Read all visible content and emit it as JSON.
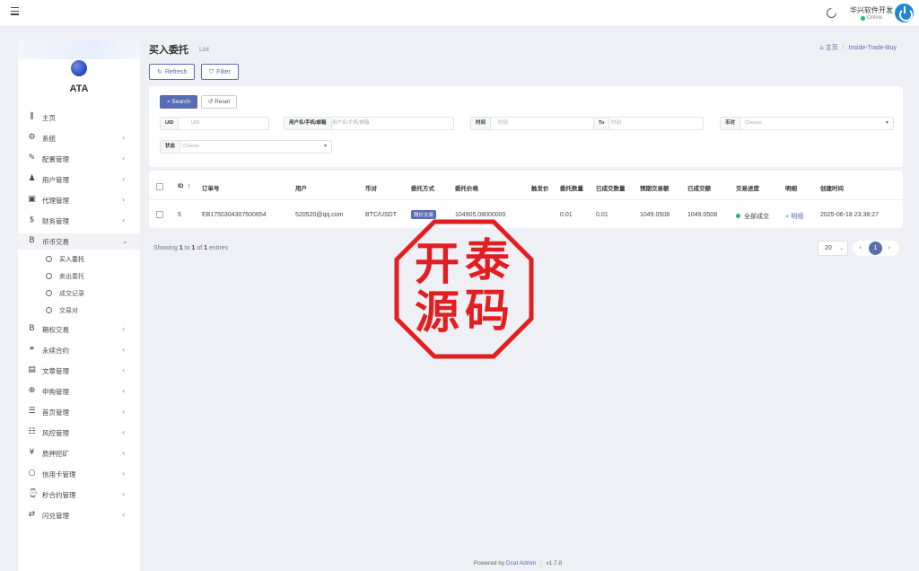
{
  "header": {
    "user_name": "华兴软件开发",
    "user_status": "Online"
  },
  "sidebar": {
    "brand": "ATA",
    "items": [
      {
        "label": "主页",
        "icon": "chart-bar-icon",
        "glyph": "⫼",
        "arrow": ""
      },
      {
        "label": "系统",
        "icon": "gear-icon",
        "glyph": "⚙",
        "arrow": "‹"
      },
      {
        "label": "配置管理",
        "icon": "wrench-icon",
        "glyph": "✎",
        "arrow": "‹"
      },
      {
        "label": "用户管理",
        "icon": "user-icon",
        "glyph": "♟",
        "arrow": "‹"
      },
      {
        "label": "代理管理",
        "icon": "id-card-icon",
        "glyph": "▣",
        "arrow": "‹"
      },
      {
        "label": "财务管理",
        "icon": "dollar-icon",
        "glyph": "$",
        "arrow": "‹"
      },
      {
        "label": "币币交易",
        "icon": "bitcoin-icon",
        "glyph": "B",
        "arrow": "⌄"
      }
    ],
    "sub_items": [
      {
        "label": "买入委托"
      },
      {
        "label": "卖出委托"
      },
      {
        "label": "成交记录"
      },
      {
        "label": "交易对"
      }
    ],
    "items_after": [
      {
        "label": "期权交易",
        "icon": "bitcoin-icon",
        "glyph": "B",
        "arrow": "‹"
      },
      {
        "label": "永续合约",
        "icon": "link-icon",
        "glyph": "⚭",
        "arrow": "‹"
      },
      {
        "label": "文章管理",
        "icon": "newspaper-icon",
        "glyph": "▤",
        "arrow": "‹"
      },
      {
        "label": "申购管理",
        "icon": "life-ring-icon",
        "glyph": "⊕",
        "arrow": "‹"
      },
      {
        "label": "首页管理",
        "icon": "list-icon",
        "glyph": "☰",
        "arrow": "‹"
      },
      {
        "label": "风控管理",
        "icon": "th-list-icon",
        "glyph": "☷",
        "arrow": "‹"
      },
      {
        "label": "质押挖矿",
        "icon": "yen-icon",
        "glyph": "¥",
        "arrow": "‹"
      },
      {
        "label": "信用卡管理",
        "icon": "circle-icon",
        "glyph": "○",
        "arrow": "‹"
      },
      {
        "label": "秒合约管理",
        "icon": "stopwatch-icon",
        "glyph": "⌚",
        "arrow": "‹"
      },
      {
        "label": "闪兑管理",
        "icon": "exchange-icon",
        "glyph": "⇄",
        "arrow": "‹"
      }
    ]
  },
  "page": {
    "title": "买入委托",
    "subtitle": "List",
    "breadcrumb_home": "主页",
    "breadcrumb_current": "Inside-Trade-Buy",
    "refresh_label": "Refresh",
    "filter_label": "Filter"
  },
  "filter": {
    "search_label": "Search",
    "reset_label": "Reset",
    "uid_label": "UID",
    "uid_placeholder": "UID",
    "user_label": "用户名/手机/邮箱",
    "user_placeholder": "用户名/手机/邮箱",
    "time_label": "时间",
    "time_from_placeholder": "时间",
    "to_label": "To",
    "time_to_placeholder": "时间",
    "pair_label": "币对",
    "pair_placeholder": "Choose",
    "status_label": "状态",
    "status_placeholder": "Choose"
  },
  "table": {
    "columns": [
      "ID",
      "订单号",
      "用户",
      "币对",
      "委托方式",
      "委托价格",
      "触发价",
      "委托数量",
      "已成交数量",
      "预期交易额",
      "已成交额",
      "交易进度",
      "明细",
      "创建时间"
    ],
    "sort_indicator": "↑",
    "rows": [
      {
        "id": "5",
        "order_no": "EB1750304307500654",
        "user": "520520@qq.com",
        "pair": "BTC/USDT",
        "method": "限价交易",
        "price": "104905.08000000",
        "trigger": "",
        "qty": "0.01",
        "filled_qty": "0.01",
        "expected": "1049.0508",
        "filled_amount": "1049.0508",
        "progress": "全部成交",
        "detail": "明细",
        "created": "2025-06-18 23:38:27"
      }
    ]
  },
  "pagination": {
    "showing_prefix": "Showing",
    "from": "1",
    "to_word": "to",
    "to": "1",
    "of_word": "of",
    "total": "1",
    "entries_word": "entries",
    "per_page": "20",
    "current_page": "1"
  },
  "stamp": {
    "chars": [
      "开",
      "泰",
      "源",
      "码"
    ],
    "color": "#e21f20"
  },
  "footer": {
    "powered": "Powered by",
    "brand": "Dcat Admin",
    "version": "v1.7.8"
  },
  "colors": {
    "primary": "#586cb1",
    "success": "#21b978",
    "avatar": "#1e87d8"
  }
}
